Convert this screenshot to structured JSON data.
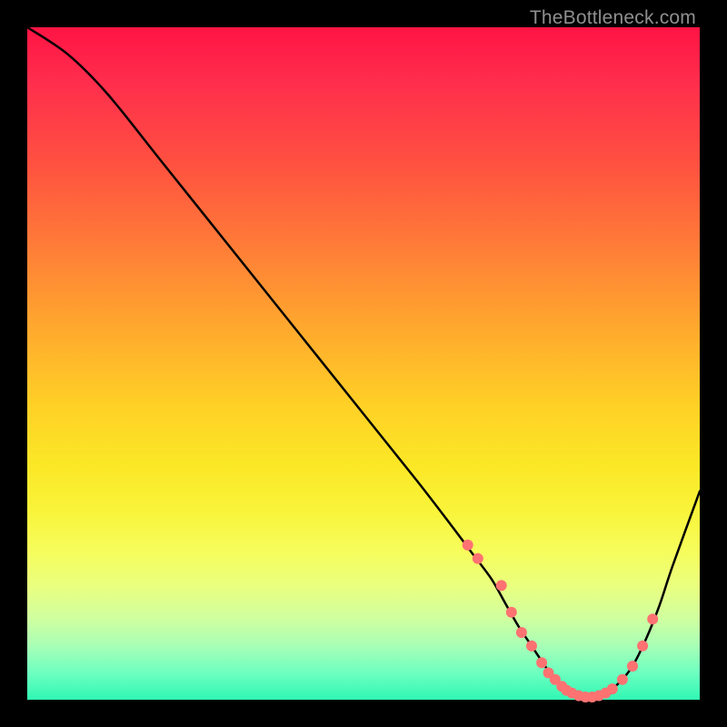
{
  "watermark": "TheBottleneck.com",
  "colors": {
    "curve_stroke": "#000000",
    "dot_fill": "#ff7272",
    "dot_stroke": "#ff7272"
  },
  "chart_data": {
    "type": "line",
    "title": "",
    "xlabel": "",
    "ylabel": "",
    "xlim": [
      0,
      100
    ],
    "ylim": [
      0,
      100
    ],
    "grid": false,
    "series": [
      {
        "name": "bottleneck-curve",
        "x": [
          0,
          6,
          12,
          20,
          30,
          40,
          50,
          58,
          63,
          66,
          69,
          71,
          73,
          75,
          77,
          78,
          79,
          80,
          81,
          82,
          83,
          84,
          85,
          86,
          88,
          90,
          92,
          94,
          96,
          100
        ],
        "y": [
          100,
          96,
          90,
          80,
          67.5,
          55,
          42.5,
          32.5,
          26,
          22,
          18,
          14.5,
          11,
          8,
          5,
          3.5,
          2.4,
          1.6,
          1.0,
          0.6,
          0.4,
          0.4,
          0.6,
          1.0,
          2.5,
          5,
          9,
          14,
          20,
          31
        ]
      }
    ],
    "markers": {
      "name": "highlight-dots",
      "x": [
        65.5,
        67,
        70.5,
        72,
        73.5,
        75,
        76.5,
        77.5,
        78.5,
        79.5,
        80.2,
        81,
        82,
        83,
        84,
        85,
        86,
        87,
        88.5,
        90,
        91.5,
        93
      ],
      "y": [
        23.0,
        21.0,
        17.0,
        13.0,
        10.0,
        8.0,
        5.5,
        4.0,
        3.0,
        2.0,
        1.4,
        1.0,
        0.6,
        0.4,
        0.4,
        0.6,
        1.0,
        1.6,
        3.0,
        5.0,
        8.0,
        12.0
      ]
    }
  }
}
